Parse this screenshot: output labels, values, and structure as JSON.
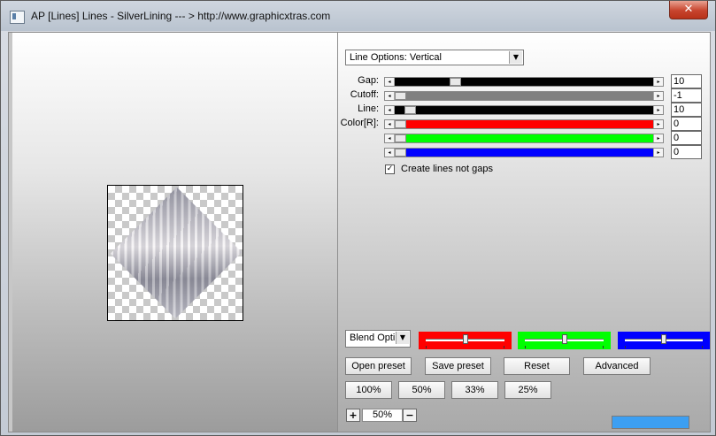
{
  "window": {
    "title": "AP [Lines]  Lines - SilverLining    --- > http://www.graphicxtras.com",
    "close_glyph": "✕"
  },
  "line_options": {
    "selected": "Line Options: Vertical",
    "arrow": "▼"
  },
  "controls": [
    {
      "label": "Gap:",
      "value": "10",
      "fill": "#000000",
      "thumb_pos": 0.22
    },
    {
      "label": "Cutoff:",
      "value": "-1",
      "fill": "#808080",
      "thumb_pos": 0.0
    },
    {
      "label": "Line:",
      "value": "10",
      "fill": "#000000",
      "thumb_pos": 0.04
    },
    {
      "label": "Color[R]:",
      "value": "0",
      "fill": "#ff0000",
      "thumb_pos": 0.0
    },
    {
      "label": "",
      "value": "0",
      "fill": "#00ff00",
      "thumb_pos": 0.0
    },
    {
      "label": "",
      "value": "0",
      "fill": "#0000ff",
      "thumb_pos": 0.0
    }
  ],
  "slider_arrows": {
    "left": "◂",
    "right": "▸"
  },
  "create_lines": {
    "label": "Create lines not gaps",
    "checked": true,
    "glyph": "✓"
  },
  "blend": {
    "selected": "Blend Opti",
    "arrow": "▼"
  },
  "blend_sliders": [
    {
      "color": "#ff0000",
      "value": 0.5
    },
    {
      "color": "#00ff00",
      "value": 0.5
    },
    {
      "color": "#0000ff",
      "value": 0.5
    }
  ],
  "buttons": {
    "open_preset": "Open preset",
    "save_preset": "Save preset",
    "reset": "Reset",
    "advanced": "Advanced"
  },
  "zoom_presets": [
    "100%",
    "50%",
    "33%",
    "25%"
  ],
  "zoom": {
    "plus": "+",
    "value": "50%",
    "minus": "−"
  },
  "progress_color": "#3c9ff2"
}
